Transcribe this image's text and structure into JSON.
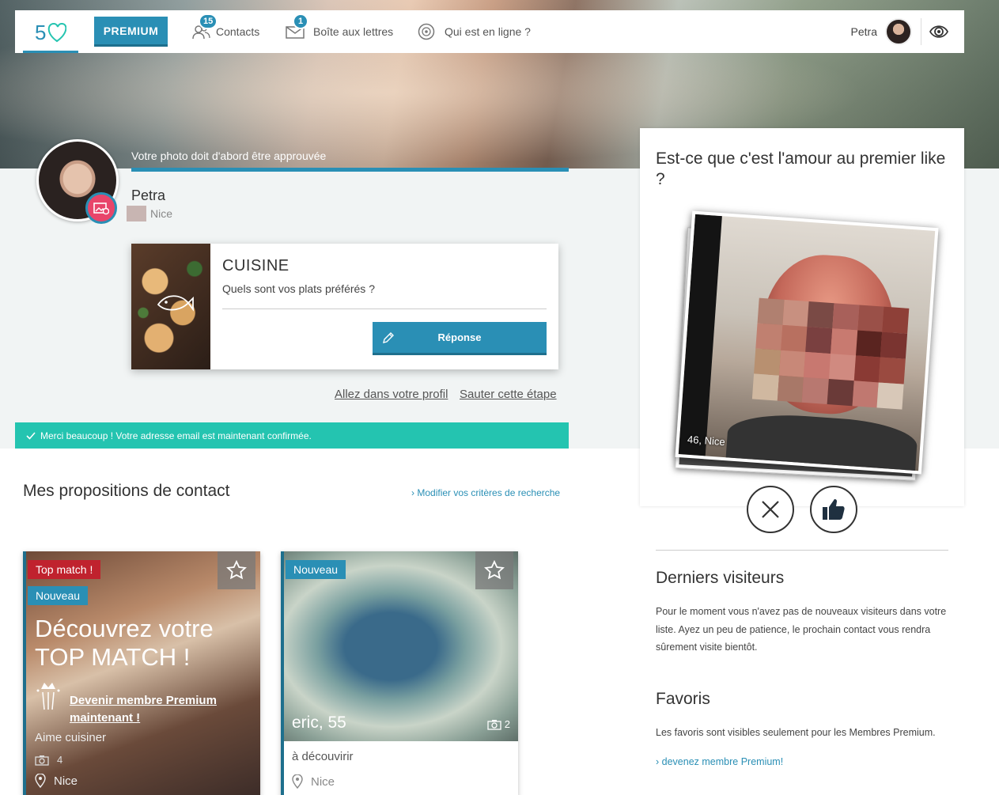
{
  "nav": {
    "premium_label": "PREMIUM",
    "contacts_label": "Contacts",
    "contacts_badge": "15",
    "mailbox_label": "Boîte aux lettres",
    "mailbox_badge": "1",
    "online_label": "Qui est en ligne ?",
    "user_name": "Petra"
  },
  "profile": {
    "approval_notice": "Votre photo doit d'abord être approuvée",
    "name": "Petra",
    "city": "Nice"
  },
  "question": {
    "category": "CUISINE",
    "text": "Quels sont vos plats préférés ?",
    "reply_label": "Réponse"
  },
  "links": {
    "profile": "Allez dans votre profil",
    "skip": "Sauter cette étape"
  },
  "confirmation": "Merci beaucoup ! Votre adresse email est maintenant confirmée.",
  "proposals": {
    "title": "Mes propositions de contact",
    "criteria_link": "Modifier vos critères de recherche",
    "cards": [
      {
        "tag_top": "Top match !",
        "tag_new": "Nouveau",
        "headline": "Découvrez votre TOP MATCH !",
        "premium_link": "Devenir membre Premium maintenant !",
        "interest": "Aime cuisiner",
        "photo_count": "4",
        "city": "Nice"
      },
      {
        "tag_new": "Nouveau",
        "name_age": "eric, 55",
        "photo_count": "2",
        "description": "à découvirir",
        "city": "Nice"
      }
    ]
  },
  "sidebar": {
    "like_title": "Est-ce que c'est l'amour au premier like ?",
    "photo_caption": "46, Nice",
    "visitors_title": "Derniers visiteurs",
    "visitors_text": "Pour le moment vous n'avez pas de nouveaux visiteurs dans votre liste. Ayez un peu de patience, le prochain contact vous rendra sûrement visite bientôt.",
    "favorites_title": "Favoris",
    "favorites_text": "Les favoris sont visibles seulement pour les Membres Premium.",
    "premium_link": "devenez membre Premium!"
  },
  "colors": {
    "accent": "#2a8fb5",
    "success": "#24c4b0",
    "danger": "#c0222e"
  }
}
